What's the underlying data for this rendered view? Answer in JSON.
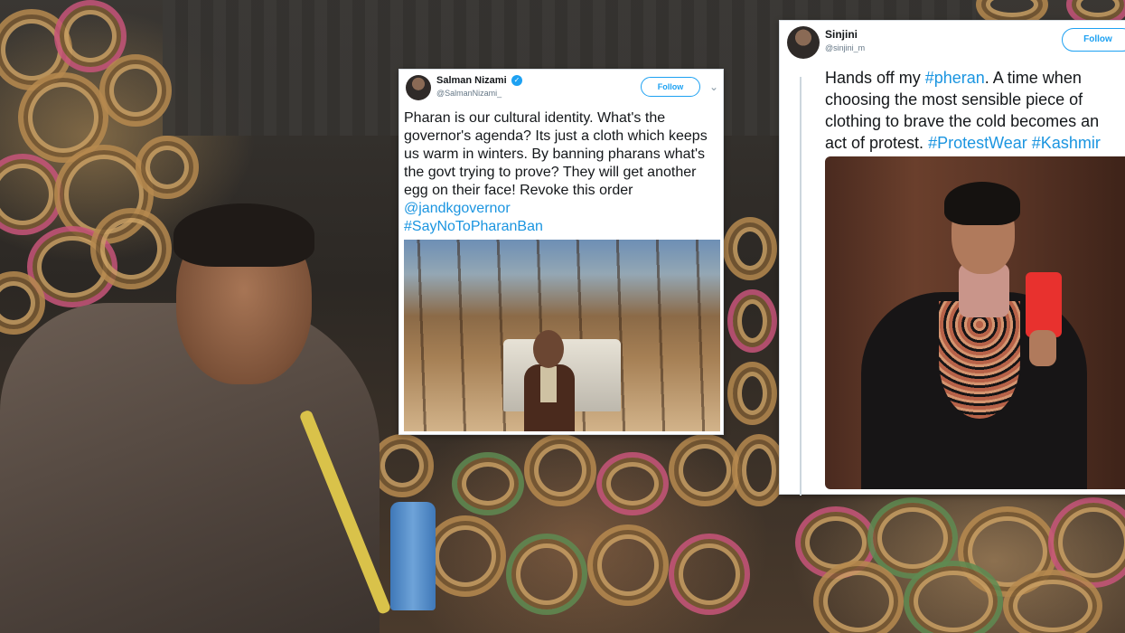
{
  "tweets": [
    {
      "display_name": "Salman Nizami",
      "handle": "@SalmanNizami_",
      "verified": true,
      "follow_label": "Follow",
      "text": "Pharan is our cultural identity. What's the governor's agenda? Its just a cloth which keeps us warm in winters. By banning pharans what's the govt trying to prove? They will get another egg on their face! Revoke this order",
      "mention": "@jandkgovernor",
      "hashtag": "#SayNoToPharanBan",
      "icons": [
        "avatar",
        "verified-badge-icon",
        "chevron-down-icon"
      ]
    },
    {
      "display_name": "Sinjini",
      "handle": "@sinjini_m",
      "follow_label": "Follow",
      "text_line1_pre": "Hands off my ",
      "text_line1_tag": "#pheran",
      "text_line1_post": ". A time when",
      "text_line2": "choosing the most sensible piece of",
      "text_line3": "clothing to brave the cold becomes an",
      "text_line4_pre": "act of protest. ",
      "text_line4_tag1": "#ProtestWear",
      "text_line4_tag2": "#Kashmir",
      "icons": [
        "avatar"
      ]
    }
  ],
  "colors": {
    "twitter_blue": "#1da1f2",
    "hashtag": "#1b95e0",
    "text": "#14171a",
    "muted": "#657786"
  }
}
